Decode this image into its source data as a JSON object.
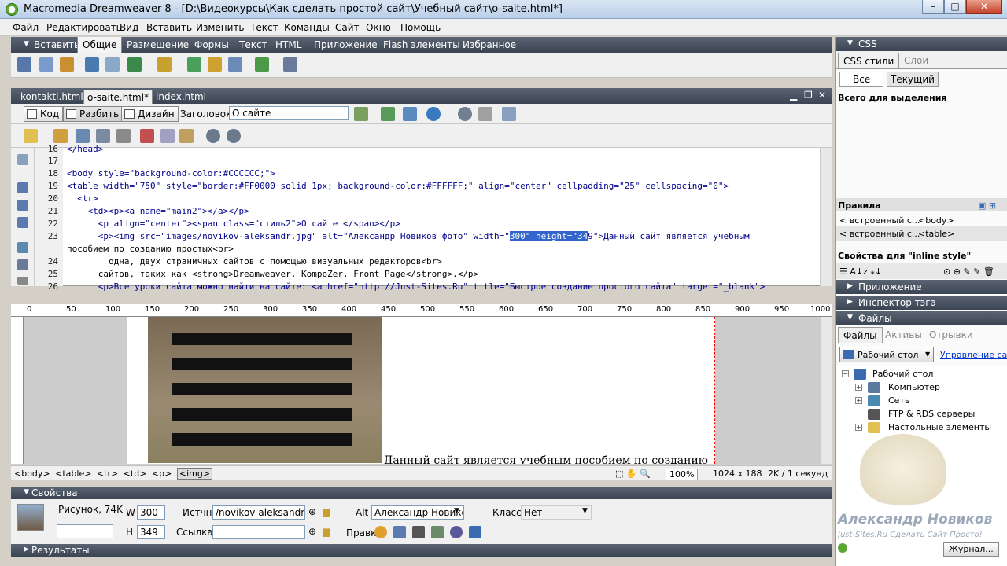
{
  "window": {
    "title": "Macromedia Dreamweaver 8 - [D:\\Видеокурсы\\Как сделать простой сайт\\Учебный сайт\\o-saite.html*]"
  },
  "menu": [
    "Файл",
    "Редактировать",
    "Вид",
    "Вставить",
    "Изменить",
    "Текст",
    "Команды",
    "Сайт",
    "Окно",
    "Помощь"
  ],
  "insert_panel": {
    "label": "Вставить",
    "tabs": [
      "Общие",
      "Размещение",
      "Формы",
      "Текст",
      "HTML",
      "Приложение",
      "Flash элементы",
      "Избранное"
    ],
    "active_tab": "Общие"
  },
  "doc_tabs": [
    "kontakti.html",
    "o-saite.html*",
    "index.html"
  ],
  "doc_toolbar": {
    "code": "Код",
    "split": "Разбить",
    "design": "Дизайн",
    "title_label": "Заголовок:",
    "title_value": "О сайте"
  },
  "code_lines": [
    {
      "n": "16",
      "t": "</head>"
    },
    {
      "n": "17",
      "t": ""
    },
    {
      "n": "18",
      "t": "<body style=\"background-color:#CCCCCC;\">"
    },
    {
      "n": "19",
      "t": "<table width=\"750\" style=\"border:#FF0000 solid 1px; background-color:#FFFFFF;\" align=\"center\" cellpadding=\"25\" cellspacing=\"0\">"
    },
    {
      "n": "20",
      "t": "  <tr>"
    },
    {
      "n": "21",
      "t": "    <td><p><a name=\"main2\"></a></p>"
    },
    {
      "n": "22",
      "t": "      <p align=\"center\"><span class=\"стиль2\">О сайте </span></p>"
    },
    {
      "n": "23",
      "t1": "      <p><img src=\"images/novikov-aleksandr.jpg\" alt=\"Александр Новиков фото\" width=\"",
      "hl": "300\" height=\"34",
      "t2": "9\">Данный сайт является учебным"
    },
    {
      "n": "",
      "t": "пособием по созданию простых<br>"
    },
    {
      "n": "24",
      "t": "        одна, двух страничных сайтов с помощью визуальных редакторов<br>"
    },
    {
      "n": "25",
      "t": "      сайтов, таких как <strong>Dreamweaver, KompoZer, Front Page</strong>.</p>"
    },
    {
      "n": "26",
      "t": "      <p>Все уроки сайта можно найти на сайте: <a href=\"http://Just-Sites.Ru\" title=\"Быстрое создание простого сайта\" target=\"_blank\">"
    }
  ],
  "ruler_ticks": [
    "0",
    "50",
    "100",
    "150",
    "200",
    "250",
    "300",
    "350",
    "400",
    "450",
    "500",
    "550",
    "600",
    "650",
    "700",
    "750",
    "800",
    "850",
    "900",
    "950",
    "1000"
  ],
  "design": {
    "text": "Данный сайт является учебным пособием по созданию"
  },
  "status": {
    "tags": [
      "<body>",
      "<table>",
      "<tr>",
      "<td>",
      "<p>",
      "<img>"
    ],
    "zoom": "100%",
    "size": "1024 x 188",
    "download": "2K / 1 секунд"
  },
  "properties": {
    "header": "Свойства",
    "kind": "Рисунок, 74K",
    "w_label": "W",
    "w_value": "300",
    "h_label": "H",
    "h_value": "349",
    "src_label": "Истчн",
    "src_value": "/novikov-aleksandr.jpg",
    "link_label": "Ссылка",
    "link_value": "",
    "alt_label": "Alt",
    "alt_value": "Александр Новико",
    "class_label": "Класс",
    "class_value": "Нет",
    "edit_label": "Правка",
    "results": "Результаты"
  },
  "right_panel": {
    "css_header": "CSS",
    "css_tabs": [
      "CSS стили",
      "Слои"
    ],
    "btn_all": "Все",
    "btn_current": "Текущий",
    "selection_label": "Всего для выделения",
    "rules_label": "Правила",
    "rules": [
      {
        "a": "< встроенный с...",
        "b": "<body>"
      },
      {
        "a": "< встроенный с...",
        "b": "<table>"
      }
    ],
    "props_label": "Свойства для \"inline style\"",
    "app_header": "Приложение",
    "tag_inspector": "Инспектор тэга",
    "files_header": "Файлы",
    "files_tabs": [
      "Файлы",
      "Активы",
      "Отрывки"
    ],
    "site_select": "Рабочий стол",
    "manage_link": "Управление са",
    "tree": [
      "Рабочий стол",
      "Компьютер",
      "Сеть",
      "FTP & RDS серверы",
      "Настольные элементы"
    ],
    "watermark_name": "Александр Новиков",
    "watermark_site": "Just-Sites.Ru  Сделать Сайт Просто!",
    "journal": "Журнал..."
  },
  "colors": {
    "highlight": "#3366cc",
    "panel_header": "#4a5462",
    "design_bg": "#cccccc",
    "table_border": "#ff0000"
  }
}
